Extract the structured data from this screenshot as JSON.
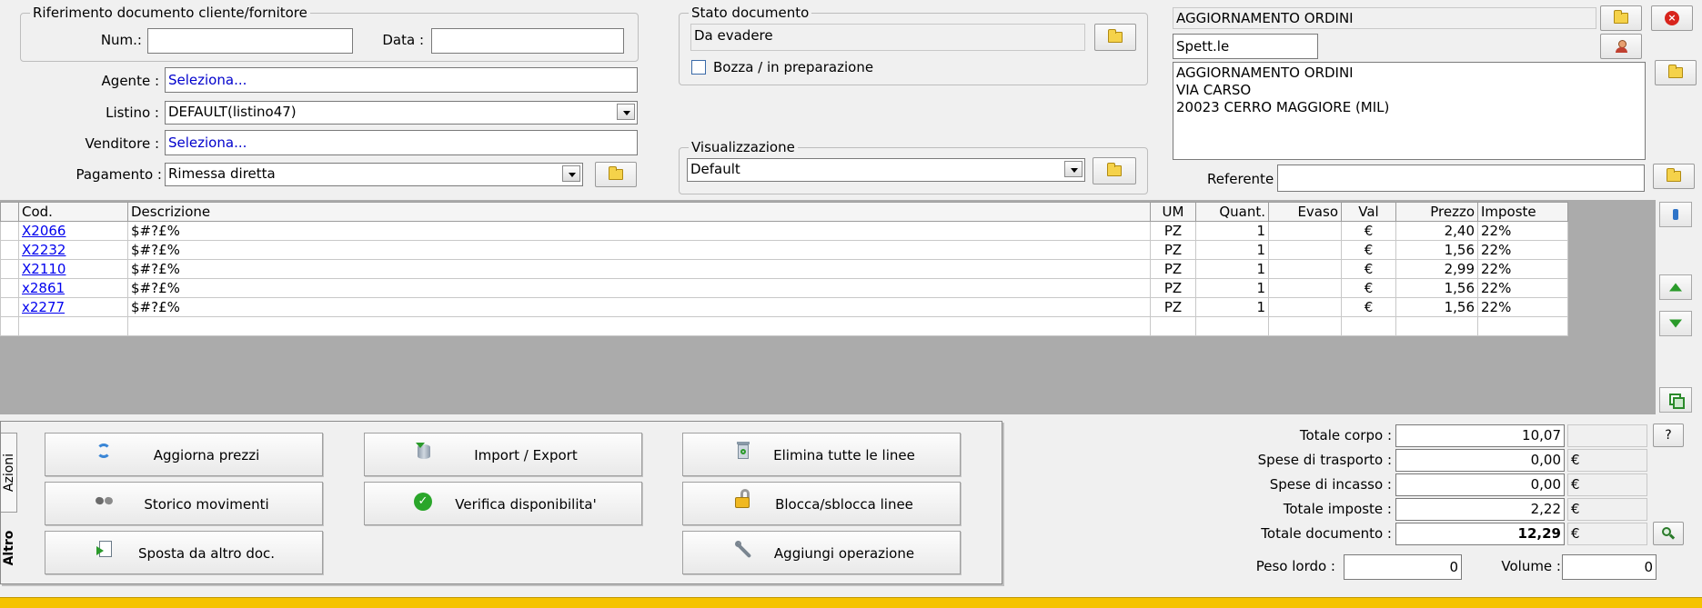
{
  "ref_group": {
    "legend": "Riferimento documento cliente/fornitore",
    "num_label": "Num.:",
    "num_value": "",
    "data_label": "Data :",
    "data_value": ""
  },
  "form": {
    "agente_label": "Agente :",
    "agente_value": "Seleziona...",
    "listino_label": "Listino :",
    "listino_value": "DEFAULT(listino47)",
    "venditore_label": "Venditore :",
    "venditore_value": "Seleziona...",
    "pagamento_label": "Pagamento :",
    "pagamento_value": "Rimessa diretta"
  },
  "stato": {
    "legend": "Stato documento",
    "value": "Da evadere",
    "bozza_label": "Bozza / in preparazione",
    "bozza_checked": false
  },
  "visual": {
    "legend": "Visualizzazione",
    "value": "Default"
  },
  "customer": {
    "name": "AGGIORNAMENTO ORDINI",
    "salutation": "Spett.le",
    "address": [
      "AGGIORNAMENTO ORDINI",
      "VIA CARSO",
      "20023 CERRO MAGGIORE (MIL)"
    ],
    "referente_label": "Referente",
    "referente_value": ""
  },
  "grid": {
    "columns": [
      "Cod.",
      "Descrizione",
      "UM",
      "Quant.",
      "Evaso",
      "Val",
      "Prezzo",
      "Imposte"
    ],
    "rows": [
      {
        "cod": "X2066",
        "desc": "$#?£%",
        "um": "PZ",
        "quant": "1",
        "evaso": "",
        "val": "€",
        "prezzo": "2,40",
        "imposte": "22%"
      },
      {
        "cod": "X2232",
        "desc": "$#?£%",
        "um": "PZ",
        "quant": "1",
        "evaso": "",
        "val": "€",
        "prezzo": "1,56",
        "imposte": "22%"
      },
      {
        "cod": "X2110",
        "desc": "$#?£%",
        "um": "PZ",
        "quant": "1",
        "evaso": "",
        "val": "€",
        "prezzo": "2,99",
        "imposte": "22%"
      },
      {
        "cod": "x2861",
        "desc": "$#?£%",
        "um": "PZ",
        "quant": "1",
        "evaso": "",
        "val": "€",
        "prezzo": "1,56",
        "imposte": "22%"
      },
      {
        "cod": "x2277",
        "desc": "$#?£%",
        "um": "PZ",
        "quant": "1",
        "evaso": "",
        "val": "€",
        "prezzo": "1,56",
        "imposte": "22%"
      }
    ]
  },
  "tabs": {
    "azioni": "Azioni",
    "altro": "Altro"
  },
  "actions": {
    "aggiorna_prezzi": "Aggiorna prezzi",
    "import_export": "Import / Export",
    "elimina_linee": "Elimina tutte le linee",
    "storico_movimenti": "Storico movimenti",
    "verifica_disponibilita": "Verifica disponibilita'",
    "blocca_linee": "Blocca/sblocca linee",
    "sposta_doc": "Sposta da altro doc.",
    "aggiungi_operazione": "Aggiungi operazione"
  },
  "totals": {
    "totale_corpo_label": "Totale corpo :",
    "totale_corpo": "10,07",
    "spese_trasporto_label": "Spese di trasporto :",
    "spese_trasporto": "0,00",
    "spese_incasso_label": "Spese di incasso :",
    "spese_incasso": "0,00",
    "totale_imposte_label": "Totale imposte :",
    "totale_imposte": "2,22",
    "totale_documento_label": "Totale documento :",
    "totale_documento": "12,29",
    "currency": "€",
    "help_label": "?",
    "peso_label": "Peso lordo :",
    "peso_value": "0",
    "volume_label": "Volume :",
    "volume_value": "0"
  },
  "colors": {
    "accent_bar": "#f5c300",
    "link": "#0000ee",
    "select_text": "#0000cc"
  }
}
